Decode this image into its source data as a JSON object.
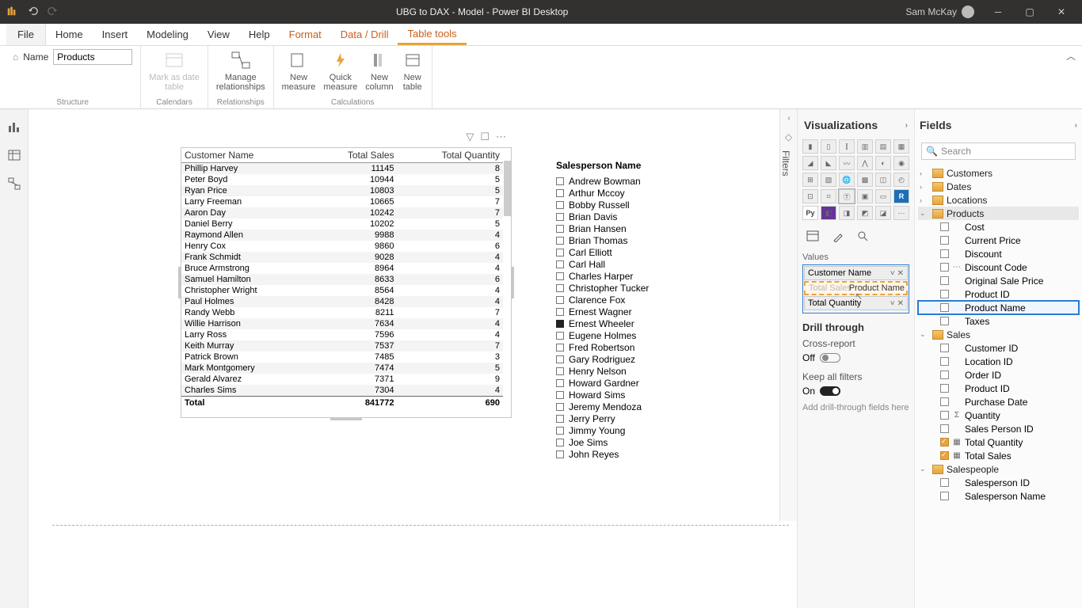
{
  "titlebar": {
    "title": "UBG to DAX - Model - Power BI Desktop",
    "user": "Sam McKay"
  },
  "ribbon": {
    "tabs": [
      "File",
      "Home",
      "Insert",
      "Modeling",
      "View",
      "Help",
      "Format",
      "Data / Drill",
      "Table tools"
    ],
    "orangeStart": 6,
    "active": 8,
    "nameLabel": "Name",
    "nameValue": "Products",
    "btnMarkDate": "Mark as date\ntable",
    "btnManageRel": "Manage\nrelationships",
    "btnQuickMeasure": "Quick\nmeasure",
    "btnNewMeasure": "New\nmeasure",
    "btnNewColumn": "New\ncolumn",
    "btnNewTable": "New\ntable",
    "groups": {
      "structure": "Structure",
      "calendars": "Calendars",
      "relationships": "Relationships",
      "calculations": "Calculations"
    }
  },
  "tableVisual": {
    "headers": [
      "Customer Name",
      "Total Sales",
      "Total Quantity"
    ],
    "rows": [
      [
        "Phillip Harvey",
        "11145",
        "8"
      ],
      [
        "Peter Boyd",
        "10944",
        "5"
      ],
      [
        "Ryan Price",
        "10803",
        "5"
      ],
      [
        "Larry Freeman",
        "10665",
        "7"
      ],
      [
        "Aaron Day",
        "10242",
        "7"
      ],
      [
        "Daniel Berry",
        "10202",
        "5"
      ],
      [
        "Raymond Allen",
        "9988",
        "4"
      ],
      [
        "Henry Cox",
        "9860",
        "6"
      ],
      [
        "Frank Schmidt",
        "9028",
        "4"
      ],
      [
        "Bruce Armstrong",
        "8964",
        "4"
      ],
      [
        "Samuel Hamilton",
        "8633",
        "6"
      ],
      [
        "Christopher Wright",
        "8564",
        "4"
      ],
      [
        "Paul Holmes",
        "8428",
        "4"
      ],
      [
        "Randy Webb",
        "8211",
        "7"
      ],
      [
        "Willie Harrison",
        "7634",
        "4"
      ],
      [
        "Larry Ross",
        "7596",
        "4"
      ],
      [
        "Keith Murray",
        "7537",
        "7"
      ],
      [
        "Patrick Brown",
        "7485",
        "3"
      ],
      [
        "Mark Montgomery",
        "7474",
        "5"
      ],
      [
        "Gerald Alvarez",
        "7371",
        "9"
      ],
      [
        "Charles Sims",
        "7304",
        "4"
      ]
    ],
    "totalLabel": "Total",
    "total": [
      "841772",
      "690"
    ]
  },
  "slicer": {
    "title": "Salesperson Name",
    "items": [
      "Andrew Bowman",
      "Arthur Mccoy",
      "Bobby Russell",
      "Brian Davis",
      "Brian Hansen",
      "Brian Thomas",
      "Carl Elliott",
      "Carl Hall",
      "Charles Harper",
      "Christopher Tucker",
      "Clarence Fox",
      "Ernest Wagner",
      "Ernest Wheeler",
      "Eugene Holmes",
      "Fred Robertson",
      "Gary Rodriguez",
      "Henry Nelson",
      "Howard Gardner",
      "Howard Sims",
      "Jeremy Mendoza",
      "Jerry Perry",
      "Jimmy Young",
      "Joe Sims",
      "John Reyes"
    ],
    "selected": 12
  },
  "filtersLabel": "Filters",
  "visPane": {
    "title": "Visualizations",
    "valuesLabel": "Values",
    "wells": [
      {
        "label": "Customer Name"
      },
      {
        "label": "Total Sales",
        "dragging": "Product Name"
      },
      {
        "label": "Total Quantity"
      }
    ],
    "drillTitle": "Drill through",
    "crossReport": "Cross-report",
    "offLabel": "Off",
    "keepFilters": "Keep all filters",
    "onLabel": "On",
    "dropHint": "Add drill-through fields here"
  },
  "fieldsPane": {
    "title": "Fields",
    "searchPlaceholder": "Search",
    "tables": [
      {
        "name": "Customers",
        "expanded": false
      },
      {
        "name": "Dates",
        "expanded": false
      },
      {
        "name": "Locations",
        "expanded": false
      },
      {
        "name": "Products",
        "expanded": true,
        "active": true,
        "fields": [
          {
            "name": "Cost"
          },
          {
            "name": "Current Price"
          },
          {
            "name": "Discount"
          },
          {
            "name": "Discount Code",
            "icon": "⋯"
          },
          {
            "name": "Original Sale Price"
          },
          {
            "name": "Product ID"
          },
          {
            "name": "Product Name",
            "highlight": true
          },
          {
            "name": "Taxes"
          }
        ]
      },
      {
        "name": "Sales",
        "expanded": true,
        "fields": [
          {
            "name": "Customer ID"
          },
          {
            "name": "Location ID"
          },
          {
            "name": "Order ID"
          },
          {
            "name": "Product ID"
          },
          {
            "name": "Purchase Date"
          },
          {
            "name": "Quantity",
            "icon": "Σ"
          },
          {
            "name": "Sales Person ID"
          },
          {
            "name": "Total Quantity",
            "checked": true,
            "icon": "▦"
          },
          {
            "name": "Total Sales",
            "checked": true,
            "icon": "▦"
          }
        ]
      },
      {
        "name": "Salespeople",
        "expanded": true,
        "fields": [
          {
            "name": "Salesperson ID"
          },
          {
            "name": "Salesperson Name"
          }
        ]
      }
    ]
  }
}
